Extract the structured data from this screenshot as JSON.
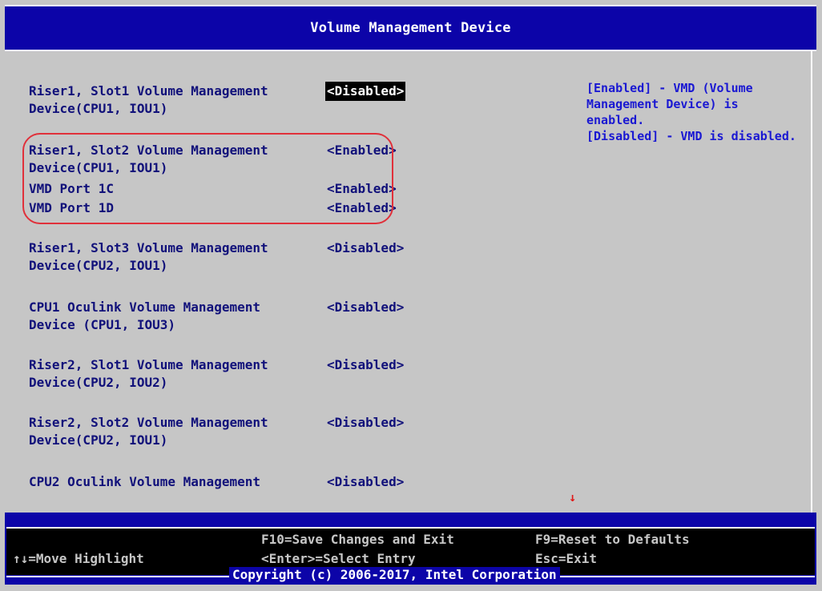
{
  "header": {
    "title": "Volume Management Device"
  },
  "settings": [
    {
      "label_line1": "Riser1, Slot1 Volume Management",
      "label_line2": "Device(CPU1, IOU1)",
      "value": "<Disabled>"
    },
    {
      "label_line1": "Riser1, Slot2 Volume Management",
      "label_line2": "Device(CPU1, IOU1)",
      "value": "<Enabled>"
    },
    {
      "label_line1": "VMD Port 1C",
      "value": "<Enabled>"
    },
    {
      "label_line1": "VMD Port 1D",
      "value": "<Enabled>"
    },
    {
      "label_line1": "Riser1, Slot3 Volume Management",
      "label_line2": "Device(CPU2, IOU1)",
      "value": "<Disabled>"
    },
    {
      "label_line1": "CPU1 Oculink Volume Management",
      "label_line2": "Device (CPU1, IOU3)",
      "value": "<Disabled>"
    },
    {
      "label_line1": "Riser2, Slot1 Volume Management",
      "label_line2": "Device(CPU2, IOU2)",
      "value": "<Disabled>"
    },
    {
      "label_line1": "Riser2, Slot2 Volume Management",
      "label_line2": "Device(CPU2, IOU1)",
      "value": "<Disabled>"
    },
    {
      "label_line1": "CPU2 Oculink Volume Management",
      "value": "<Disabled>"
    }
  ],
  "help": [
    "[Enabled] - VMD (Volume",
    "Management Device) is",
    "enabled.",
    "[Disabled] - VMD is disabled."
  ],
  "scroll_indicator": "↓",
  "footer": {
    "move_highlight": "↑↓=Move Highlight",
    "f10": "F10=Save Changes and Exit",
    "enter": "<Enter>=Select Entry",
    "f9": "F9=Reset to Defaults",
    "esc": "Esc=Exit",
    "copyright": "Copyright (c) 2006-2017, Intel Corporation"
  },
  "colors": {
    "header_bg": "#0c04a8",
    "panel_bg": "#c6c6c6",
    "label_text": "#11117a",
    "help_text": "#1a18d2",
    "highlight_ring": "#e0303a"
  }
}
